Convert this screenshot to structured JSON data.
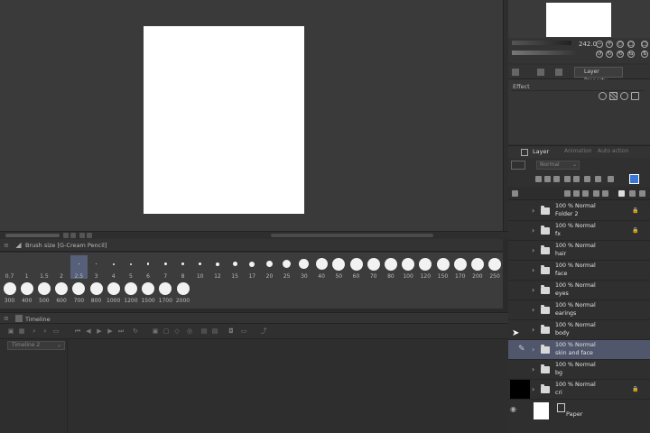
{
  "brush_palette": {
    "title": "Brush size [G-Cream Pencil]",
    "sizes": [
      {
        "label": "0.7",
        "dot": 0
      },
      {
        "label": "1",
        "dot": 0
      },
      {
        "label": "1.5",
        "dot": 0
      },
      {
        "label": "2",
        "dot": 0
      },
      {
        "label": "2.5",
        "dot": 1,
        "selected": true
      },
      {
        "label": "3",
        "dot": 1.5
      },
      {
        "label": "4",
        "dot": 2
      },
      {
        "label": "5",
        "dot": 2
      },
      {
        "label": "6",
        "dot": 2.5
      },
      {
        "label": "7",
        "dot": 3
      },
      {
        "label": "8",
        "dot": 3
      },
      {
        "label": "10",
        "dot": 3.5
      },
      {
        "label": "12",
        "dot": 4
      },
      {
        "label": "15",
        "dot": 5
      },
      {
        "label": "17",
        "dot": 6
      },
      {
        "label": "20",
        "dot": 7
      },
      {
        "label": "25",
        "dot": 9
      },
      {
        "label": "30",
        "dot": 11
      },
      {
        "label": "40",
        "dot": 13
      },
      {
        "label": "50",
        "dot": 14
      },
      {
        "label": "60",
        "dot": 14
      },
      {
        "label": "70",
        "dot": 14
      },
      {
        "label": "80",
        "dot": 14
      },
      {
        "label": "100",
        "dot": 14
      },
      {
        "label": "120",
        "dot": 14
      },
      {
        "label": "150",
        "dot": 14
      },
      {
        "label": "170",
        "dot": 14
      },
      {
        "label": "200",
        "dot": 14
      },
      {
        "label": "250",
        "dot": 14
      },
      {
        "label": "300",
        "dot": 14
      },
      {
        "label": "400",
        "dot": 14
      },
      {
        "label": "500",
        "dot": 14
      },
      {
        "label": "600",
        "dot": 14
      },
      {
        "label": "700",
        "dot": 14
      },
      {
        "label": "800",
        "dot": 14
      },
      {
        "label": "1000",
        "dot": 14
      },
      {
        "label": "1200",
        "dot": 14
      },
      {
        "label": "1500",
        "dot": 14
      },
      {
        "label": "1700",
        "dot": 14
      },
      {
        "label": "2000",
        "dot": 14
      }
    ]
  },
  "timeline": {
    "title": "Timeline",
    "dropdown": "Timeline 2"
  },
  "navigator": {
    "zoom_value": "242.0"
  },
  "layer_property": {
    "tab_label": "Layer Property",
    "effect_label": "Effect"
  },
  "layer_panel": {
    "tabs": [
      "Layer",
      "Animation",
      "Auto action"
    ],
    "blend_mode": "Normal",
    "layers": [
      {
        "line1": "100 % Normal",
        "line2": "Folder 2",
        "locked": true
      },
      {
        "line1": "100 % Normal",
        "line2": "fx",
        "locked": true
      },
      {
        "line1": "100 % Normal",
        "line2": "hair",
        "locked": false
      },
      {
        "line1": "100 % Normal",
        "line2": "face",
        "locked": false
      },
      {
        "line1": "100 % Normal",
        "line2": "eyes",
        "locked": false
      },
      {
        "line1": "100 % Normal",
        "line2": "earings",
        "locked": false
      },
      {
        "line1": "100 % Normal",
        "line2": "body",
        "locked": false
      },
      {
        "line1": "100 % Normal",
        "line2": "skin and face",
        "locked": false,
        "selected": true
      },
      {
        "line1": "100 % Normal",
        "line2": "bg",
        "locked": false
      },
      {
        "line1": "100 % Normal",
        "line2": "cri",
        "locked": true,
        "black_thumb": true
      }
    ],
    "paper_label": "Paper"
  },
  "colors": {
    "canvas_bg": "#3a3a3a",
    "paper": "#ffffff",
    "selection": "#50566c",
    "panel_bg": "#2f2f2f"
  }
}
